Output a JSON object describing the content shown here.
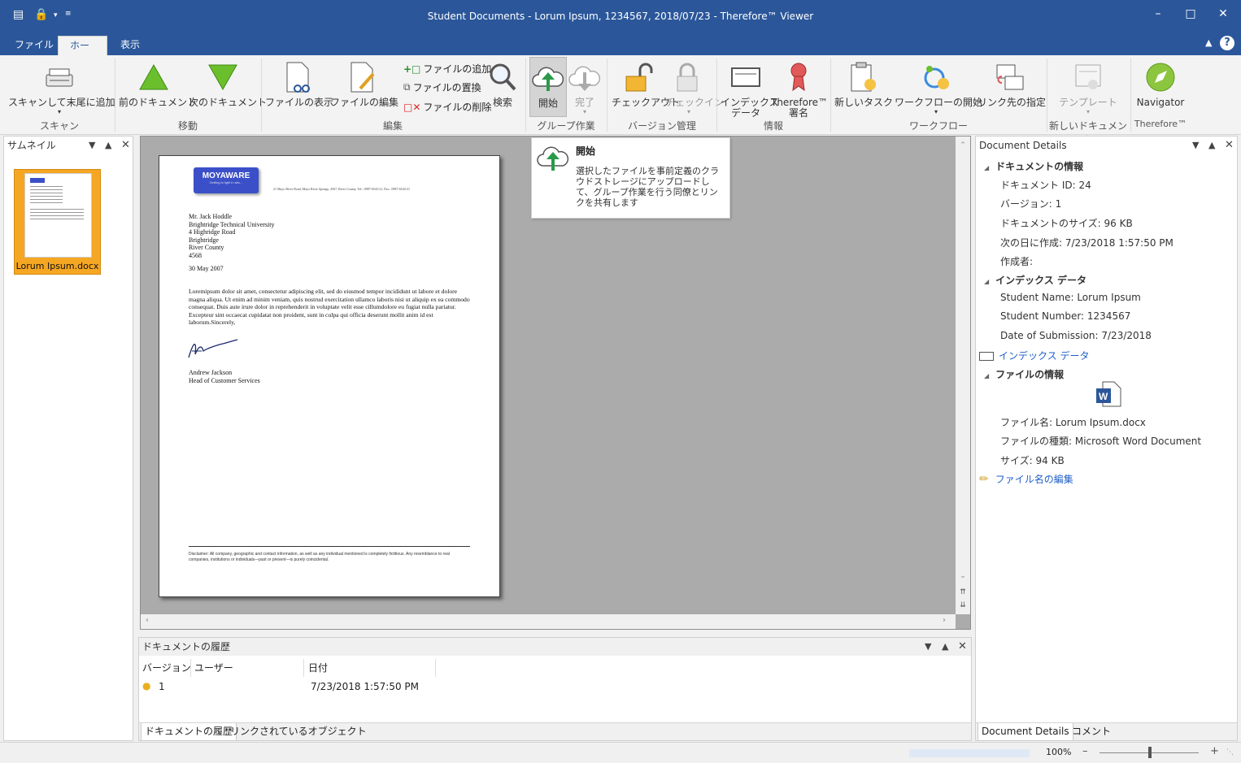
{
  "window": {
    "title": "Student Documents - Lorum Ipsum, 1234567, 2018/07/23 - Therefore™ Viewer"
  },
  "tabs": [
    "ファイル",
    "ホーム",
    "表示"
  ],
  "ribbon": {
    "scan_add": "スキャンして末尾に追加",
    "group_scan": "スキャン",
    "prev_doc": "前のドキュメント",
    "next_doc": "次のドキュメント",
    "group_move": "移動",
    "view_file": "ファイルの表示",
    "edit_file": "ファイルの編集",
    "add_file": "ファイルの追加",
    "replace_file": "ファイルの置換",
    "delete_file": "ファイルの削除",
    "search": "検索",
    "group_edit": "編集",
    "start": "開始",
    "complete": "完了",
    "group_group_work": "グループ作業",
    "checkout": "チェックアウト",
    "checkin": "チェックイン",
    "group_version": "バージョン管理",
    "index_data_1": "インデックス",
    "index_data_2": "データ",
    "therefore_sign_1": "Therefore™",
    "therefore_sign_2": "署名",
    "group_info": "情報",
    "new_task": "新しいタスク",
    "start_workflow": "ワークフローの開始",
    "link_target": "リンク先の指定",
    "group_workflow": "ワークフロー",
    "template": "テンプレート",
    "group_new_doc": "新しいドキュメント",
    "navigator": "Navigator",
    "group_therefore": "Therefore™"
  },
  "tooltip": {
    "title": "開始",
    "body": "選択したファイルを事前定義のクラウドストレージにアップロードして、グループ作業を行う同僚とリンクを共有します"
  },
  "thumbnails": {
    "title": "サムネイル",
    "item": "Lorum Ipsum.docx"
  },
  "document": {
    "logo": "MOYAWARE",
    "logo_tag": "Getting to light in abc...",
    "address_line": "21 Mayo River Road, Mayo River Springs, 4567, River County, Tel.: 0987-6543-21, Fax.: 0987-6543-21",
    "recipient": [
      "Mr. Jack Hoddle",
      "Brightridge Technical University",
      "4 Highridge Road",
      "Brightridge",
      "River County",
      "4568"
    ],
    "date": "30 May 2007",
    "body": "Loremipsum dolor sit amet, consectetur adipiscing elit, sed do eiusmod tempor incididunt ut labore et dolore magna aliqua. Ut enim ad minim veniam, quis nostrud exercitation ullamco laboris nisi ut aliquip ex ea commodo consequat. Duis aute irure dolor in reprehenderit in voluptate velit esse cillumdolore eu fugiat nulla pariatur. Excepteur sint occaecat cupidatat non proident, sunt in culpa qui officia deserunt mollit anim id est laborum.Sincerely,",
    "signer": "Andrew Jackson",
    "signer_title": "Head of Customer Services",
    "disclaimer": "Disclaimer: All company, geographic and contact information, as well as any individual mentioned is completely fictitious.  Any resemblance to real companies, institutions or individuals—past or present—is purely coincidental."
  },
  "history": {
    "title": "ドキュメントの履歴",
    "col_version": "バージョン",
    "col_user": "ユーザー",
    "col_date": "日付",
    "rows": [
      {
        "version": "1",
        "user": "",
        "date": "7/23/2018 1:57:50 PM"
      }
    ],
    "tab_history": "ドキュメントの履歴",
    "tab_linked": "リンクされているオブジェクト"
  },
  "details": {
    "title": "Document Details",
    "sec_doc_info": "ドキュメントの情報",
    "doc_id": "ドキュメント ID: 24",
    "version": "バージョン: 1",
    "doc_size": "ドキュメントのサイズ: 96 KB",
    "created": "次の日に作成: 7/23/2018 1:57:50 PM",
    "author": "作成者:",
    "sec_index": "インデックス データ",
    "student_name": "Student Name:  Lorum Ipsum",
    "student_number": "Student Number:  1234567",
    "date_submission": "Date of Submission:  7/23/2018",
    "index_link": "インデックス データ",
    "sec_file_info": "ファイルの情報",
    "file_name": "ファイル名: Lorum Ipsum.docx",
    "file_type": "ファイルの種類: Microsoft Word Document",
    "file_size": "サイズ: 94 KB",
    "edit_file_name": "ファイル名の編集",
    "tab_details": "Document Details",
    "tab_comment": "コメント"
  },
  "status": {
    "zoom": "100%",
    "minus": "–",
    "plus": "+"
  },
  "colors": {
    "accent": "#2b579a",
    "thumb_select": "#f5a623",
    "link": "#1f5fc8"
  }
}
